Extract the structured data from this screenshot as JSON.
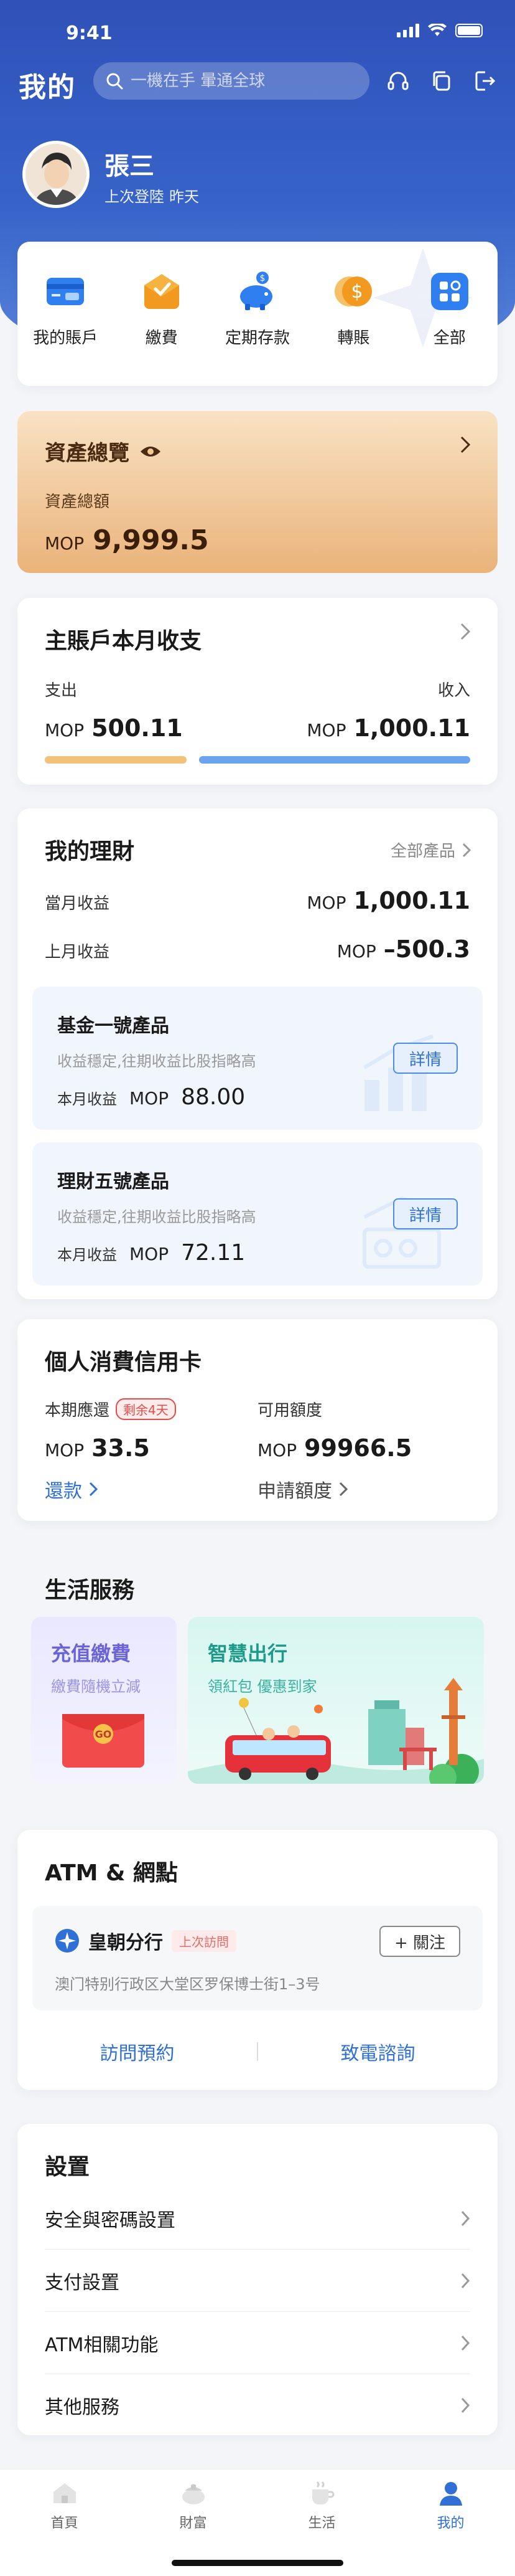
{
  "status": {
    "time": "9:41"
  },
  "header": {
    "title": "我的",
    "search_placeholder": "一機在手 暈通全球"
  },
  "profile": {
    "name": "張三",
    "last_login_label": "上次登陸",
    "last_login_value": "昨天"
  },
  "quick_actions": [
    {
      "label": "我的賬戶",
      "icon": "account-card-icon"
    },
    {
      "label": "繳費",
      "icon": "pay-bill-icon"
    },
    {
      "label": "定期存款",
      "icon": "piggy-bank-icon"
    },
    {
      "label": "轉賬",
      "icon": "transfer-icon"
    },
    {
      "label": "全部",
      "icon": "all-apps-icon"
    }
  ],
  "assets": {
    "title": "資產總覽",
    "sub_label": "資產總額",
    "currency": "MOP",
    "amount": "9,999.5"
  },
  "income": {
    "title": "主賬戶本月收支",
    "expense_label": "支出",
    "income_label": "收入",
    "currency": "MOP",
    "expense_value": "500.11",
    "income_value": "1,000.11",
    "expense_share": 0.333
  },
  "wealth": {
    "title": "我的理財",
    "all_link": "全部產品",
    "rows": [
      {
        "label": "當月收益",
        "currency": "MOP",
        "value": "1,000.11"
      },
      {
        "label": "上月收益",
        "currency": "MOP",
        "value": "–500.3"
      }
    ],
    "products": [
      {
        "name": "基金一號產品",
        "desc": "收益穩定,往期收益比股指略高",
        "earn_label": "本月收益",
        "currency": "MOP",
        "earn": "88.00",
        "button": "詳情"
      },
      {
        "name": "理財五號產品",
        "desc": "收益穩定,往期收益比股指略高",
        "earn_label": "本月收益",
        "currency": "MOP",
        "earn": "72.11",
        "button": "詳情"
      }
    ]
  },
  "credit": {
    "title": "個人消費信用卡",
    "due_label": "本期應還",
    "due_badge": "剩余4天",
    "due_currency": "MOP",
    "due_value": "33.5",
    "limit_label": "可用額度",
    "limit_currency": "MOP",
    "limit_value": "99966.5",
    "repay_link": "還款",
    "raise_link": "申請額度"
  },
  "life": {
    "title": "生活服務",
    "card_a": {
      "title": "充值繳費",
      "subtitle": "繳費隨機立減",
      "tag": "GO"
    },
    "card_b": {
      "title": "智慧出行",
      "subtitle": "領紅包 優惠到家"
    }
  },
  "atm": {
    "title": "ATM & 網點",
    "branch_name": "皇朝分行",
    "branch_tag": "上次訪問",
    "follow": "+ 關注",
    "address": "澳门特别行政区大堂区罗保博士街1–3号",
    "action_visit": "訪問預約",
    "action_call": "致電諮詢"
  },
  "settings": {
    "title": "設置",
    "items": [
      "安全與密碼設置",
      "支付設置",
      "ATM相關功能",
      "其他服務"
    ]
  },
  "tabbar": [
    {
      "label": "首頁",
      "icon": "home-icon",
      "active": false
    },
    {
      "label": "財富",
      "icon": "wealth-icon",
      "active": false
    },
    {
      "label": "生活",
      "icon": "coffee-icon",
      "active": false
    },
    {
      "label": "我的",
      "icon": "person-icon",
      "active": true
    }
  ],
  "colors": {
    "primary": "#3763c9",
    "accent_blue": "#2f6fd6",
    "gold": "#eab37a",
    "danger": "#e64a4a"
  }
}
